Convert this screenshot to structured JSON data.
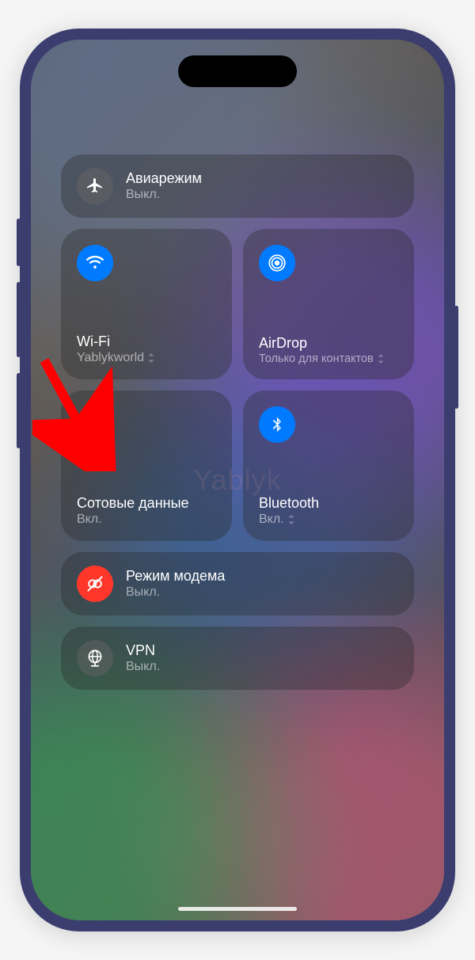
{
  "watermark": "Yablyk",
  "tiles": {
    "airplane": {
      "title": "Авиарежим",
      "status": "Выкл."
    },
    "wifi": {
      "title": "Wi-Fi",
      "status": "Yablykworld",
      "expandable": true
    },
    "airdrop": {
      "title": "AirDrop",
      "status": "Только для контактов",
      "expandable": true
    },
    "cellular": {
      "title": "Сотовые данные",
      "status": "Вкл."
    },
    "bluetooth": {
      "title": "Bluetooth",
      "status": "Вкл.",
      "expandable": true
    },
    "hotspot": {
      "title": "Режим модема",
      "status": "Выкл."
    },
    "vpn": {
      "title": "VPN",
      "status": "Выкл."
    }
  },
  "colors": {
    "active_blue": "#0a7aff",
    "active_green": "#34c759",
    "inactive_dark": "rgba(100,100,100,0.5)",
    "hotspot_off": "#ff3b30"
  },
  "annotation": {
    "type": "arrow",
    "points_to": "cellular-data-toggle",
    "color": "#ff0000"
  }
}
